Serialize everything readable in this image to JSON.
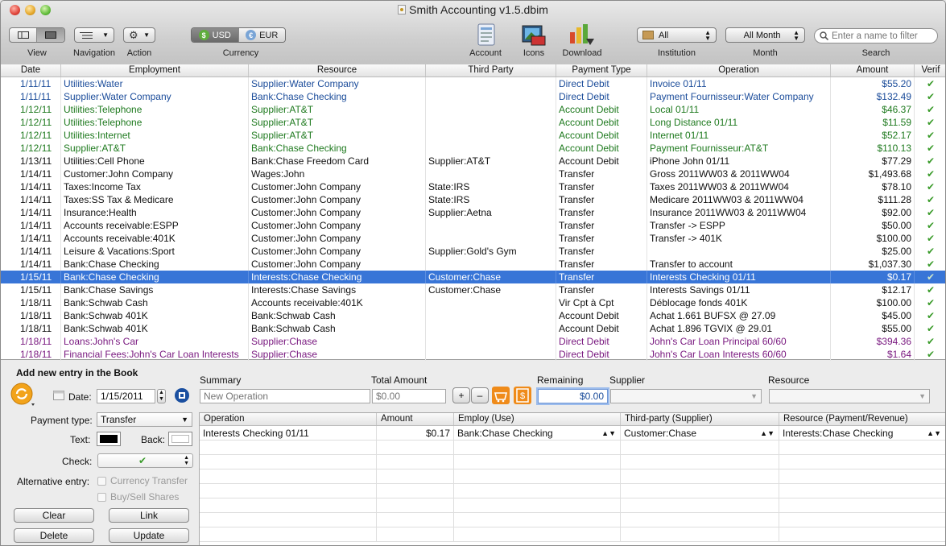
{
  "window": {
    "title": "Smith Accounting v1.5.dbim"
  },
  "toolbar": {
    "view_label": "View",
    "navigation_label": "Navigation",
    "action_label": "Action",
    "currency_label": "Currency",
    "currency_usd": "USD",
    "currency_eur": "EUR",
    "account_label": "Account",
    "icons_label": "Icons",
    "download_label": "Download",
    "institution_label": "Institution",
    "institution_value": "All",
    "month_label": "Month",
    "month_value": "All Month",
    "search_label": "Search",
    "search_placeholder": "Enter a name to filter"
  },
  "table": {
    "columns": [
      "Date",
      "Employment",
      "Resource",
      "Third Party",
      "Payment Type",
      "Operation",
      "Amount",
      "Verif"
    ],
    "rows": [
      {
        "date": "1/11/11",
        "employment": "Utilities:Water",
        "resource": "Supplier:Water Company",
        "third": "",
        "pay": "Direct Debit",
        "op": "Invoice 01/11",
        "amount": "$55.20",
        "color": "blue"
      },
      {
        "date": "1/11/11",
        "employment": "Supplier:Water Company",
        "resource": "Bank:Chase Checking",
        "third": "",
        "pay": "Direct Debit",
        "op": "Payment Fournisseur:Water Company",
        "amount": "$132.49",
        "color": "blue"
      },
      {
        "date": "1/12/11",
        "employment": "Utilities:Telephone",
        "resource": "Supplier:AT&T",
        "third": "",
        "pay": "Account Debit",
        "op": "Local 01/11",
        "amount": "$46.37",
        "color": "green"
      },
      {
        "date": "1/12/11",
        "employment": "Utilities:Telephone",
        "resource": "Supplier:AT&T",
        "third": "",
        "pay": "Account Debit",
        "op": "Long Distance 01/11",
        "amount": "$11.59",
        "color": "green"
      },
      {
        "date": "1/12/11",
        "employment": "Utilities:Internet",
        "resource": "Supplier:AT&T",
        "third": "",
        "pay": "Account Debit",
        "op": "Internet 01/11",
        "amount": "$52.17",
        "color": "green"
      },
      {
        "date": "1/12/11",
        "employment": "Supplier:AT&T",
        "resource": "Bank:Chase Checking",
        "third": "",
        "pay": "Account Debit",
        "op": "Payment Fournisseur:AT&T",
        "amount": "$110.13",
        "color": "green"
      },
      {
        "date": "1/13/11",
        "employment": "Utilities:Cell Phone",
        "resource": "Bank:Chase Freedom Card",
        "third": "Supplier:AT&T",
        "pay": "Account Debit",
        "op": "iPhone John 01/11",
        "amount": "$77.29",
        "color": "black"
      },
      {
        "date": "1/14/11",
        "employment": "Customer:John Company",
        "resource": "Wages:John",
        "third": "",
        "pay": "Transfer",
        "op": "Gross 2011WW03 & 2011WW04",
        "amount": "$1,493.68",
        "color": "black"
      },
      {
        "date": "1/14/11",
        "employment": "Taxes:Income Tax",
        "resource": "Customer:John Company",
        "third": "State:IRS",
        "pay": "Transfer",
        "op": "Taxes 2011WW03 & 2011WW04",
        "amount": "$78.10",
        "color": "black"
      },
      {
        "date": "1/14/11",
        "employment": "Taxes:SS Tax & Medicare",
        "resource": "Customer:John Company",
        "third": "State:IRS",
        "pay": "Transfer",
        "op": "Medicare 2011WW03 & 2011WW04",
        "amount": "$111.28",
        "color": "black"
      },
      {
        "date": "1/14/11",
        "employment": "Insurance:Health",
        "resource": "Customer:John Company",
        "third": "Supplier:Aetna",
        "pay": "Transfer",
        "op": "Insurance 2011WW03 & 2011WW04",
        "amount": "$92.00",
        "color": "black"
      },
      {
        "date": "1/14/11",
        "employment": "Accounts receivable:ESPP",
        "resource": "Customer:John Company",
        "third": "",
        "pay": "Transfer",
        "op": "Transfer -> ESPP",
        "amount": "$50.00",
        "color": "black"
      },
      {
        "date": "1/14/11",
        "employment": "Accounts receivable:401K",
        "resource": "Customer:John Company",
        "third": "",
        "pay": "Transfer",
        "op": "Transfer -> 401K",
        "amount": "$100.00",
        "color": "black"
      },
      {
        "date": "1/14/11",
        "employment": "Leisure & Vacations:Sport",
        "resource": "Customer:John Company",
        "third": "Supplier:Gold's Gym",
        "pay": "Transfer",
        "op": "",
        "amount": "$25.00",
        "color": "black"
      },
      {
        "date": "1/14/11",
        "employment": "Bank:Chase Checking",
        "resource": "Customer:John Company",
        "third": "",
        "pay": "Transfer",
        "op": "Transfer to account",
        "amount": "$1,037.30",
        "color": "black"
      },
      {
        "date": "1/15/11",
        "employment": "Bank:Chase Checking",
        "resource": "Interests:Chase Checking",
        "third": "Customer:Chase",
        "pay": "Transfer",
        "op": "Interests Checking 01/11",
        "amount": "$0.17",
        "color": "black",
        "selected": true
      },
      {
        "date": "1/15/11",
        "employment": "Bank:Chase Savings",
        "resource": "Interests:Chase Savings",
        "third": "Customer:Chase",
        "pay": "Transfer",
        "op": "Interests Savings 01/11",
        "amount": "$12.17",
        "color": "black"
      },
      {
        "date": "1/18/11",
        "employment": "Bank:Schwab Cash",
        "resource": "Accounts receivable:401K",
        "third": "",
        "pay": "Vir Cpt à Cpt",
        "op": "Déblocage fonds 401K",
        "amount": "$100.00",
        "color": "black"
      },
      {
        "date": "1/18/11",
        "employment": "Bank:Schwab 401K",
        "resource": "Bank:Schwab Cash",
        "third": "",
        "pay": "Account Debit",
        "op": "Achat 1.661 BUFSX @ 27.09",
        "amount": "$45.00",
        "color": "black"
      },
      {
        "date": "1/18/11",
        "employment": "Bank:Schwab 401K",
        "resource": "Bank:Schwab Cash",
        "third": "",
        "pay": "Account Debit",
        "op": "Achat 1.896 TGVIX @ 29.01",
        "amount": "$55.00",
        "color": "black"
      },
      {
        "date": "1/18/11",
        "employment": "Loans:John's Car",
        "resource": "Supplier:Chase",
        "third": "",
        "pay": "Direct Debit",
        "op": "John's Car Loan Principal 60/60",
        "amount": "$394.36",
        "color": "purple"
      },
      {
        "date": "1/18/11",
        "employment": "Financial Fees:John's Car Loan Interests",
        "resource": "Supplier:Chase",
        "third": "",
        "pay": "Direct Debit",
        "op": "John's Car Loan Interests 60/60",
        "amount": "$1.64",
        "color": "purple"
      }
    ]
  },
  "entry": {
    "heading": "Add new entry in the Book",
    "date_label": "Date:",
    "date_value": "1/15/2011",
    "summary_label": "Summary",
    "summary_placeholder": "New Operation",
    "total_label": "Total Amount",
    "total_placeholder": "$0.00",
    "plus": "+",
    "minus": "–",
    "remaining_label": "Remaining",
    "remaining_value": "$0.00",
    "supplier_label": "Supplier",
    "resource_label": "Resource",
    "payment_type_label": "Payment type:",
    "payment_type_value": "Transfer",
    "text_label": "Text:",
    "back_label": "Back:",
    "check_label": "Check:",
    "alternative_label": "Alternative entry:",
    "currency_transfer": "Currency Transfer",
    "buy_sell": "Buy/Sell Shares",
    "clear": "Clear",
    "link": "Link",
    "delete": "Delete",
    "update": "Update",
    "sub_columns": [
      "Operation",
      "Amount",
      "Employ (Use)",
      "Third-party (Supplier)",
      "Resource (Payment/Revenue)"
    ],
    "sub_rows": [
      {
        "op": "Interests Checking 01/11",
        "amount": "$0.17",
        "employ": "Bank:Chase Checking",
        "third": "Customer:Chase",
        "resource": "Interests:Chase Checking"
      }
    ]
  },
  "colors": {
    "selection": "#3875d7",
    "blue_text": "#1b4c9a",
    "green_text": "#1f7a1f",
    "purple_text": "#7a1a80",
    "check": "#3a9b2a"
  }
}
